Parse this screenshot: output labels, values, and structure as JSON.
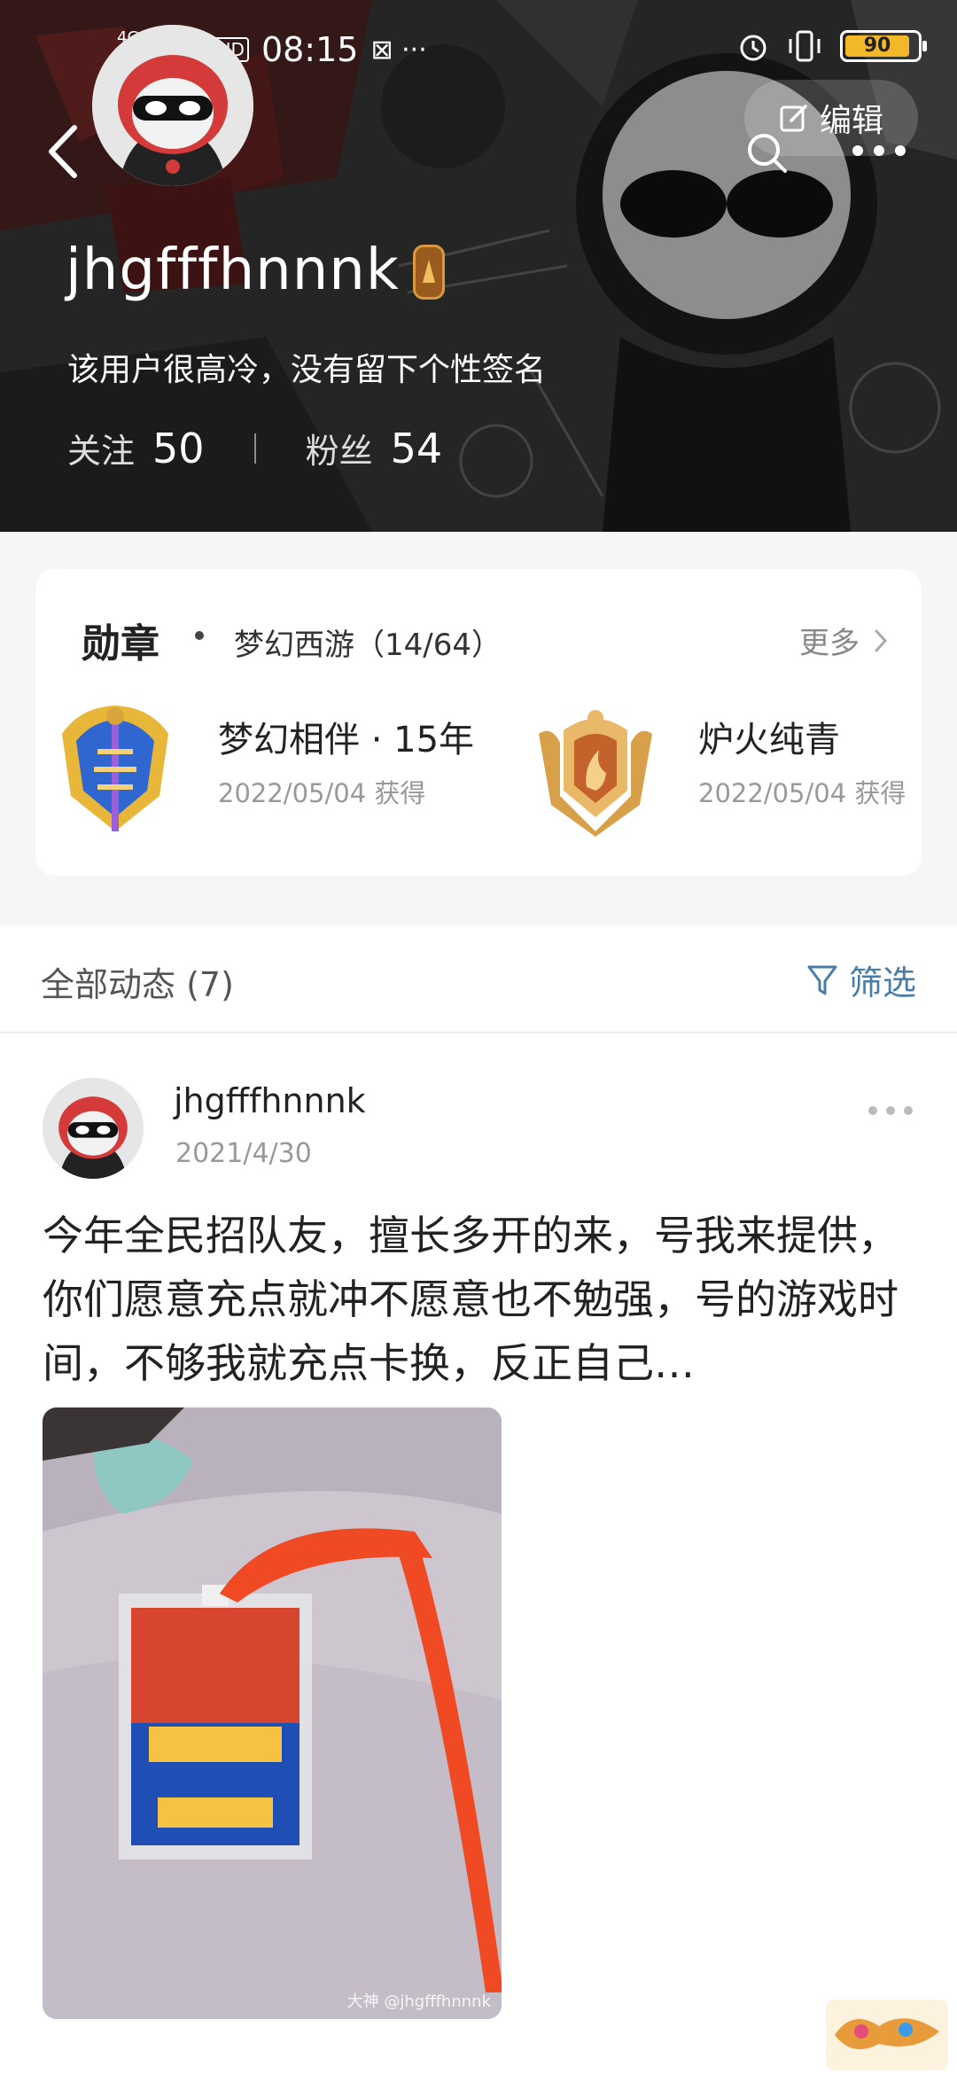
{
  "status_bar": {
    "network": "4G+",
    "hd": "HD",
    "time": "08:15",
    "extra": "⊠ ···",
    "battery": "90"
  },
  "header": {
    "edit_label": "编辑",
    "username": "jhgfffhnnnk",
    "signature": "该用户很高冷，没有留下个性签名",
    "following_label": "关注",
    "following_count": "50",
    "followers_label": "粉丝",
    "followers_count": "54"
  },
  "medals": {
    "title": "勋章",
    "game": "梦幻西游（14/64）",
    "more_label": "更多",
    "items": [
      {
        "name": "梦幻相伴 · 15年",
        "date": "2022/05/04 获得"
      },
      {
        "name": "炉火纯青",
        "date": "2022/05/04 获得"
      }
    ]
  },
  "feed": {
    "title": "全部动态 (7)",
    "filter_label": "筛选",
    "post": {
      "user": "jhgfffhnnnk",
      "date": "2021/4/30",
      "text": "今年全民招队友，擅长多开的来，号我来提供，你们愿意充点就冲不愿意也不勉强，号的游戏时间，不够我就充点卡换，反正自己…",
      "image_watermark": "大神 @jhgfffhnnnk"
    }
  }
}
